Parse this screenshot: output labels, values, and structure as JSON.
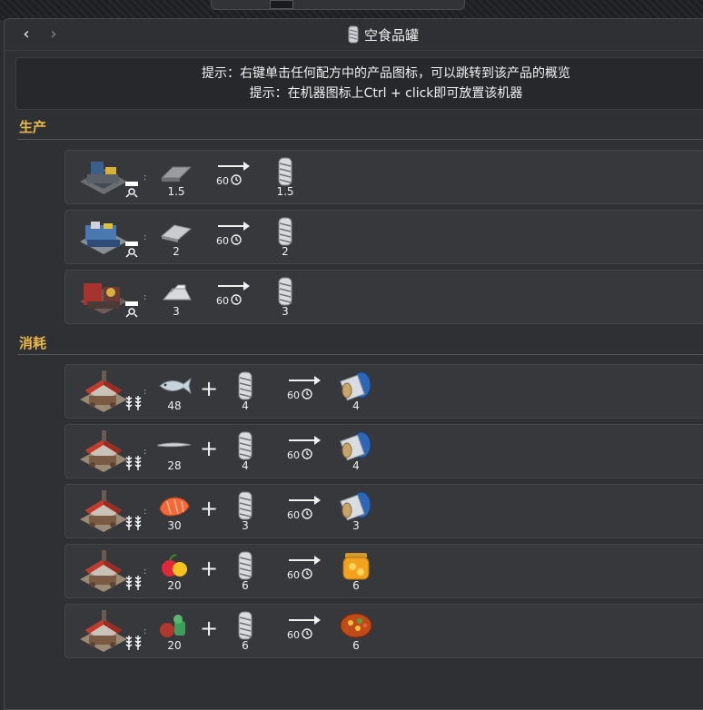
{
  "topbar": {
    "partial_text": ""
  },
  "header": {
    "title": "空食品罐",
    "title_icon": "empty-can-icon",
    "back_icon": "chevron-left-icon",
    "forward_icon": "chevron-right-icon"
  },
  "hints": [
    "提示：右键单击任何配方中的产品图标，可以跳转到该产品的概览",
    "提示：在机器图标上Ctrl + click即可放置该机器"
  ],
  "sections": {
    "production": {
      "label": "生产"
    },
    "consumption": {
      "label": "消耗"
    }
  },
  "production": [
    {
      "machine": "metal-press-basic-icon",
      "inputs": [
        {
          "icon": "iron-plate-icon",
          "qty": "1.5"
        }
      ],
      "time": "60",
      "outputs": [
        {
          "icon": "empty-can-icon",
          "qty": "1.5"
        }
      ]
    },
    {
      "machine": "metal-press-advanced-icon",
      "inputs": [
        {
          "icon": "steel-plate-icon",
          "qty": "2"
        }
      ],
      "time": "60",
      "outputs": [
        {
          "icon": "empty-can-icon",
          "qty": "2"
        }
      ]
    },
    {
      "machine": "metal-press-heavy-icon",
      "inputs": [
        {
          "icon": "aluminum-ingot-icon",
          "qty": "3"
        }
      ],
      "time": "60",
      "outputs": [
        {
          "icon": "empty-can-icon",
          "qty": "3"
        }
      ]
    }
  ],
  "consumption": [
    {
      "machine": "cannery-icon",
      "inputs": [
        {
          "icon": "fish-icon",
          "qty": "48"
        },
        {
          "icon": "empty-can-icon",
          "qty": "4"
        }
      ],
      "time": "60",
      "outputs": [
        {
          "icon": "canned-fish-icon",
          "qty": "4"
        }
      ]
    },
    {
      "machine": "cannery-icon",
      "inputs": [
        {
          "icon": "eel-icon",
          "qty": "28"
        },
        {
          "icon": "empty-can-icon",
          "qty": "4"
        }
      ],
      "time": "60",
      "outputs": [
        {
          "icon": "canned-fish-icon",
          "qty": "4"
        }
      ]
    },
    {
      "machine": "cannery-icon",
      "inputs": [
        {
          "icon": "salmon-fillet-icon",
          "qty": "30"
        },
        {
          "icon": "empty-can-icon",
          "qty": "3"
        }
      ],
      "time": "60",
      "outputs": [
        {
          "icon": "canned-fish-icon",
          "qty": "3"
        }
      ]
    },
    {
      "machine": "cannery-icon",
      "inputs": [
        {
          "icon": "fruit-icon",
          "qty": "20"
        },
        {
          "icon": "empty-can-icon",
          "qty": "6"
        }
      ],
      "time": "60",
      "outputs": [
        {
          "icon": "fruit-jar-icon",
          "qty": "6"
        }
      ]
    },
    {
      "machine": "cannery-icon",
      "inputs": [
        {
          "icon": "vegetables-icon",
          "qty": "20"
        },
        {
          "icon": "empty-can-icon",
          "qty": "6"
        }
      ],
      "time": "60",
      "outputs": [
        {
          "icon": "stew-bowl-icon",
          "qty": "6"
        }
      ]
    }
  ]
}
